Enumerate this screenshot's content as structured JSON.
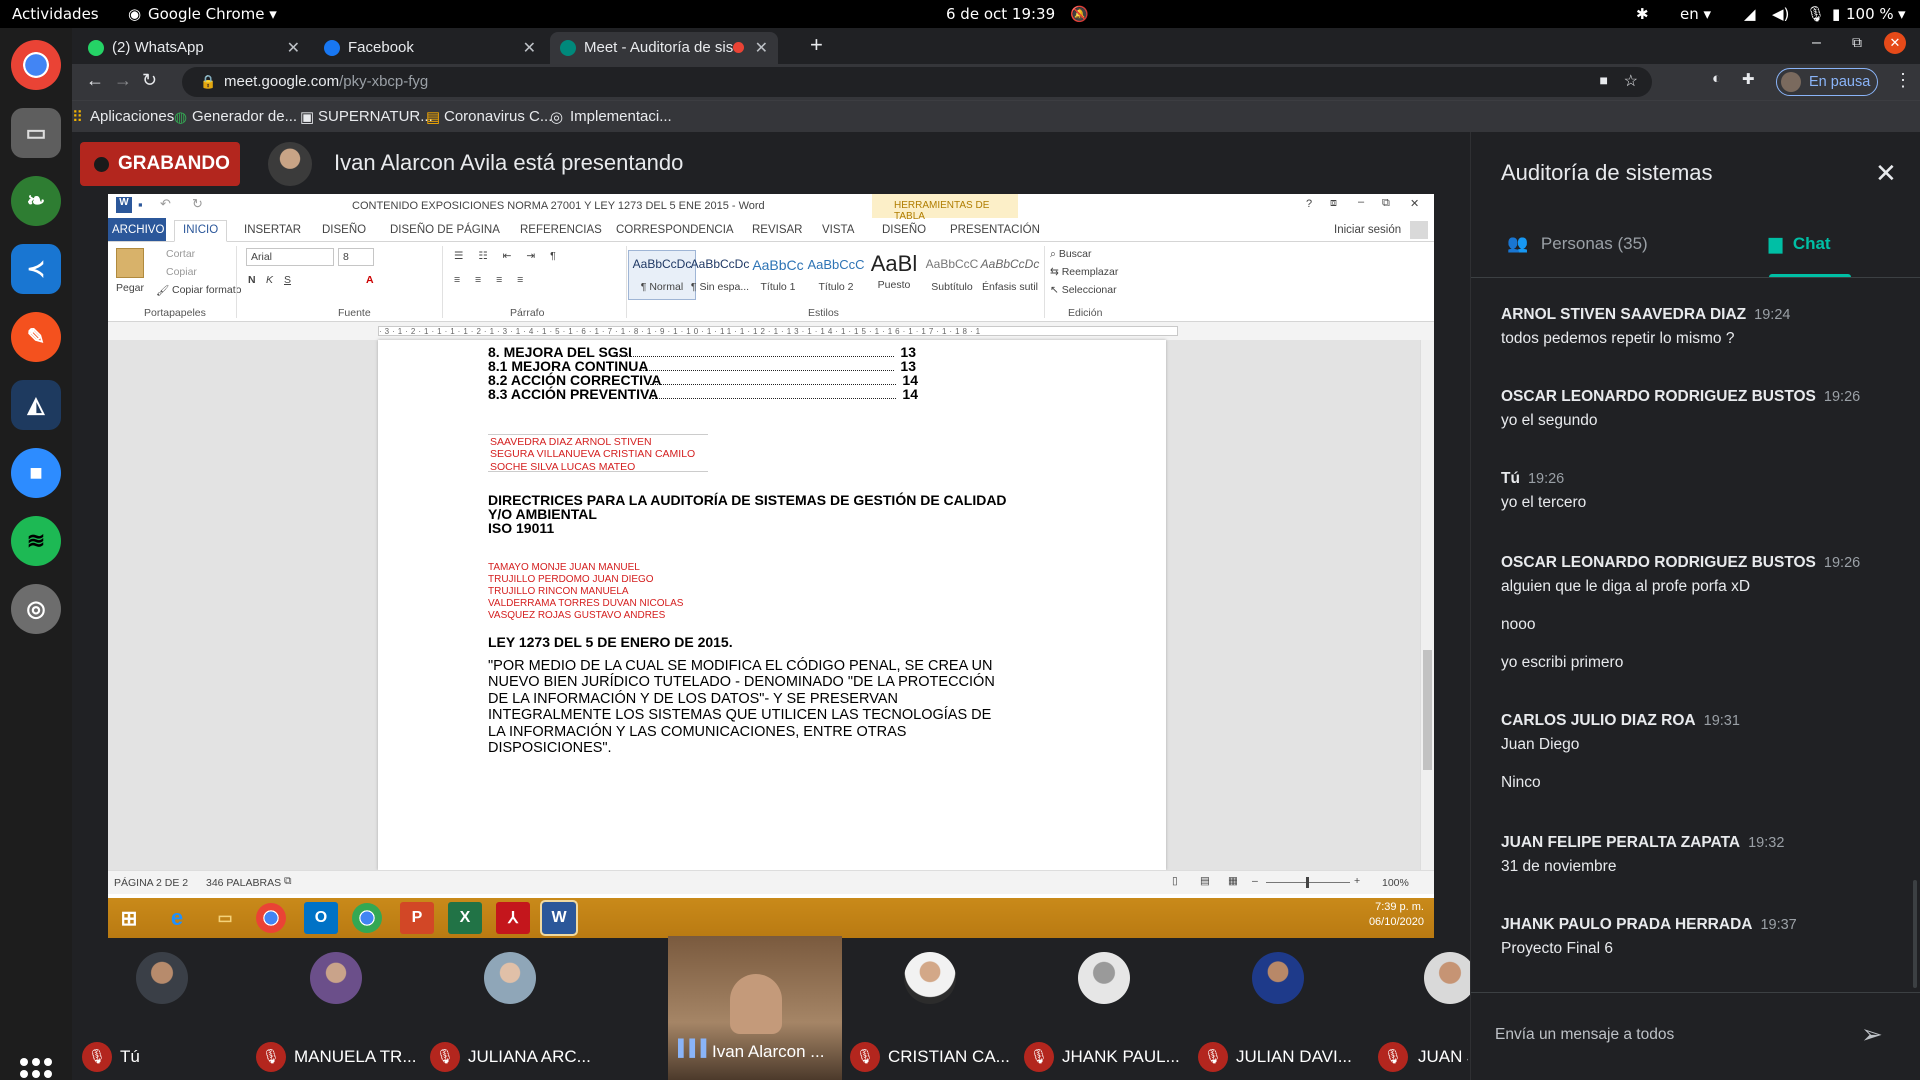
{
  "topbar": {
    "activities": "Actividades",
    "app_menu": "Google Chrome ▾",
    "datetime": "6 de oct  19:39",
    "lang": "en ▾",
    "battery": "100 %"
  },
  "chrome": {
    "tabs": [
      {
        "label": "(2) WhatsApp"
      },
      {
        "label": "Facebook"
      },
      {
        "label": "Meet - Auditoría de sis"
      }
    ],
    "url_host": "meet.google.com",
    "url_path": "/pky-xbcp-fyg",
    "profile_status": "En pausa",
    "bookmarks": [
      "Aplicaciones",
      "Generador de...",
      "SUPERNATUR...",
      "Coronavirus C...",
      "Implementaci..."
    ]
  },
  "meet": {
    "recording_label": "GRABANDO",
    "presenting_text": "Ivan Alarcon Avila está presentando",
    "participants": [
      {
        "name": "Tú"
      },
      {
        "name": "MANUELA TR..."
      },
      {
        "name": "JULIANA ARC..."
      },
      {
        "name": "Ivan Alarcon ..."
      },
      {
        "name": "CRISTIAN CA..."
      },
      {
        "name": "JHANK PAUL..."
      },
      {
        "name": "JULIAN DAVI..."
      },
      {
        "name": "JUAN JOSE F..."
      }
    ]
  },
  "word": {
    "title": "CONTENIDO EXPOSICIONES NORMA 27001 Y LEY 1273 DEL 5 ENE 2015 - Word",
    "tools_label": "HERRAMIENTAS DE TABLA",
    "signin": "Iniciar sesión",
    "tabs": [
      "ARCHIVO",
      "INICIO",
      "INSERTAR",
      "DISEÑO",
      "DISEÑO DE PÁGINA",
      "REFERENCIAS",
      "CORRESPONDENCIA",
      "REVISAR",
      "VISTA",
      "DISEÑO",
      "PRESENTACIÓN"
    ],
    "clipboard": {
      "paste": "Pegar",
      "cut": "Cortar",
      "copy": "Copiar",
      "format": "Copiar formato",
      "label": "Portapapeles"
    },
    "font": {
      "name": "Arial",
      "size": "8",
      "label": "Fuente"
    },
    "paragraph_label": "Párrafo",
    "styles": [
      {
        "preview": "AaBbCcDc",
        "name": "¶ Normal"
      },
      {
        "preview": "AaBbCcDc",
        "name": "¶ Sin espa..."
      },
      {
        "preview": "AaBbCc",
        "name": "Título 1"
      },
      {
        "preview": "AaBbCcC",
        "name": "Título 2"
      },
      {
        "preview": "AaBl",
        "name": "Puesto"
      },
      {
        "preview": "AaBbCcC",
        "name": "Subtítulo"
      },
      {
        "preview": "AaBbCcDc",
        "name": "Énfasis sutil"
      }
    ],
    "styles_label": "Estilos",
    "editing": {
      "find": "Buscar",
      "replace": "Reemplazar",
      "select": "Seleccionar",
      "label": "Edición"
    },
    "doc": {
      "toc": [
        {
          "text": "8. MEJORA DEL SGSI",
          "page": "13"
        },
        {
          "text": "8.1 MEJORA CONTINUA",
          "page": "13"
        },
        {
          "text": "8.2 ACCIÓN CORRECTIVA",
          "page": "14"
        },
        {
          "text": "8.3 ACCIÓN PREVENTIVA",
          "page": "14"
        }
      ],
      "group1": [
        "SAAVEDRA DIAZ ARNOL STIVEN",
        "SEGURA VILLANUEVA CRISTIAN CAMILO",
        "SOCHE SILVA LUCAS MATEO"
      ],
      "heading1": [
        "DIRECTRICES PARA LA AUDITORÍA DE SISTEMAS DE GESTIÓN DE CALIDAD",
        "Y/O AMBIENTAL",
        "ISO 19011"
      ],
      "group2": [
        "TAMAYO MONJE JUAN MANUEL",
        "TRUJILLO PERDOMO JUAN DIEGO",
        "TRUJILLO RINCON MANUELA",
        "VALDERRAMA TORRES DUVAN NICOLAS",
        "VASQUEZ ROJAS GUSTAVO ANDRES"
      ],
      "heading2": "LEY 1273 DEL 5 DE ENERO DE 2015.",
      "body": "\"POR MEDIO DE LA CUAL SE MODIFICA EL CÓDIGO PENAL, SE CREA UN NUEVO BIEN JURÍDICO TUTELADO - DENOMINADO \"DE LA PROTECCIÓN DE LA INFORMACIÓN Y DE LOS DATOS\"- Y SE PRESERVAN INTEGRALMENTE LOS SISTEMAS QUE UTILICEN LAS TECNOLOGÍAS DE LA INFORMACIÓN Y LAS COMUNICACIONES, ENTRE OTRAS DISPOSICIONES\"."
    },
    "status": {
      "page": "PÁGINA 2 DE 2",
      "words": "346 PALABRAS",
      "zoom": "100%"
    },
    "taskbar_time": "7:39 p. m.",
    "taskbar_date": "06/10/2020"
  },
  "chat": {
    "title": "Auditoría de sistemas",
    "people_tab": "Personas (35)",
    "chat_tab": "Chat",
    "messages": [
      {
        "sender": "ARNOL STIVEN SAAVEDRA DIAZ",
        "time": "19:24",
        "lines": [
          "todos pedemos repetir lo mismo ?"
        ]
      },
      {
        "sender": "OSCAR LEONARDO RODRIGUEZ BUSTOS",
        "time": "19:26",
        "lines": [
          "yo el segundo"
        ]
      },
      {
        "sender": "Tú",
        "time": "19:26",
        "lines": [
          "yo el tercero"
        ]
      },
      {
        "sender": "OSCAR LEONARDO RODRIGUEZ BUSTOS",
        "time": "19:26",
        "lines": [
          "alguien que le diga al profe porfa xD",
          "nooo",
          "yo escribi primero"
        ]
      },
      {
        "sender": "CARLOS JULIO DIAZ ROA",
        "time": "19:31",
        "lines": [
          "Juan Diego",
          "Ninco"
        ]
      },
      {
        "sender": "JUAN FELIPE PERALTA ZAPATA",
        "time": "19:32",
        "lines": [
          "31 de noviembre"
        ]
      },
      {
        "sender": "JHANK PAULO PRADA HERRADA",
        "time": "19:37",
        "lines": [
          "Proyecto Final 6"
        ]
      }
    ],
    "compose_placeholder": "Envía un mensaje a todos"
  },
  "colors": {
    "recording": "#b3261e",
    "accent": "#00bfa5",
    "word_blue": "#2b579a",
    "doc_red": "#d42020"
  }
}
